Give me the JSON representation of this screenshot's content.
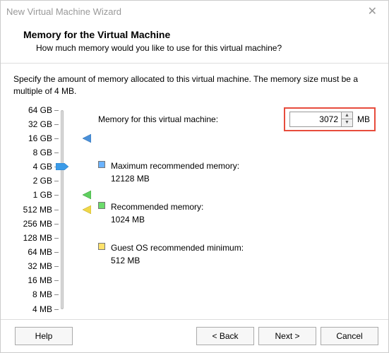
{
  "window": {
    "title": "New Virtual Machine Wizard"
  },
  "header": {
    "title": "Memory for the Virtual Machine",
    "subtitle": "How much memory would you like to use for this virtual machine?"
  },
  "intro": "Specify the amount of memory allocated to this virtual machine. The memory size must be a multiple of 4 MB.",
  "memory": {
    "label": "Memory for this virtual machine:",
    "value": "3072",
    "unit": "MB"
  },
  "slider": {
    "ticks": [
      "64 GB",
      "32 GB",
      "16 GB",
      "8 GB",
      "4 GB",
      "2 GB",
      "1 GB",
      "512 MB",
      "256 MB",
      "128 MB",
      "64 MB",
      "32 MB",
      "16 MB",
      "8 MB",
      "4 MB"
    ],
    "thumb_value": "4 GB",
    "pointers": {
      "blue_at": "16 GB",
      "green_at": "1 GB",
      "yellow_at": "512 MB"
    }
  },
  "legend": {
    "max": {
      "label": "Maximum recommended memory:",
      "value": "12128 MB",
      "color": "#6bb3ff"
    },
    "rec": {
      "label": "Recommended memory:",
      "value": "1024 MB",
      "color": "#6bdc6b"
    },
    "min": {
      "label": "Guest OS recommended minimum:",
      "value": "512 MB",
      "color": "#ffe26b"
    }
  },
  "footer": {
    "help": "Help",
    "back": "< Back",
    "next": "Next >",
    "cancel": "Cancel"
  }
}
